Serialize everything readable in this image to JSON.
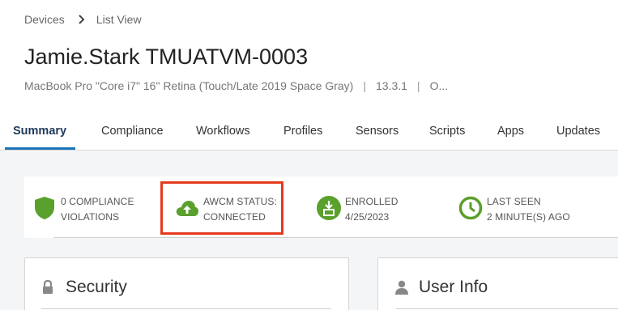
{
  "breadcrumb": {
    "items": [
      "Devices",
      "List View"
    ]
  },
  "device": {
    "title": "Jamie.Stark TMUATVM-0003",
    "model": "MacBook Pro \"Core i7\" 16\" Retina (Touch/Late 2019 Space Gray)",
    "os_version": "13.3.1",
    "owner_truncated": "O..."
  },
  "tabs": [
    {
      "label": "Summary",
      "active": true
    },
    {
      "label": "Compliance"
    },
    {
      "label": "Workflows"
    },
    {
      "label": "Profiles"
    },
    {
      "label": "Sensors"
    },
    {
      "label": "Scripts"
    },
    {
      "label": "Apps"
    },
    {
      "label": "Updates"
    }
  ],
  "status": {
    "compliance": {
      "line1": "0 COMPLIANCE",
      "line2": "VIOLATIONS",
      "icon": "shield-icon",
      "color": "#5aa02c"
    },
    "awcm": {
      "line1": "AWCM STATUS:",
      "line2": "CONNECTED",
      "icon": "cloud-upload-icon",
      "color": "#5aa02c"
    },
    "enrolled": {
      "line1": "ENROLLED",
      "line2": "4/25/2023",
      "icon": "enroll-icon",
      "color": "#5aa02c"
    },
    "last_seen": {
      "line1": "LAST SEEN",
      "line2": "2 MINUTE(S) AGO",
      "icon": "clock-icon",
      "color": "#5aa02c"
    }
  },
  "highlight_color": "#e53a1e",
  "cards": {
    "security": {
      "title": "Security",
      "icon": "lock-icon"
    },
    "user_info": {
      "title": "User Info",
      "icon": "user-icon"
    }
  }
}
